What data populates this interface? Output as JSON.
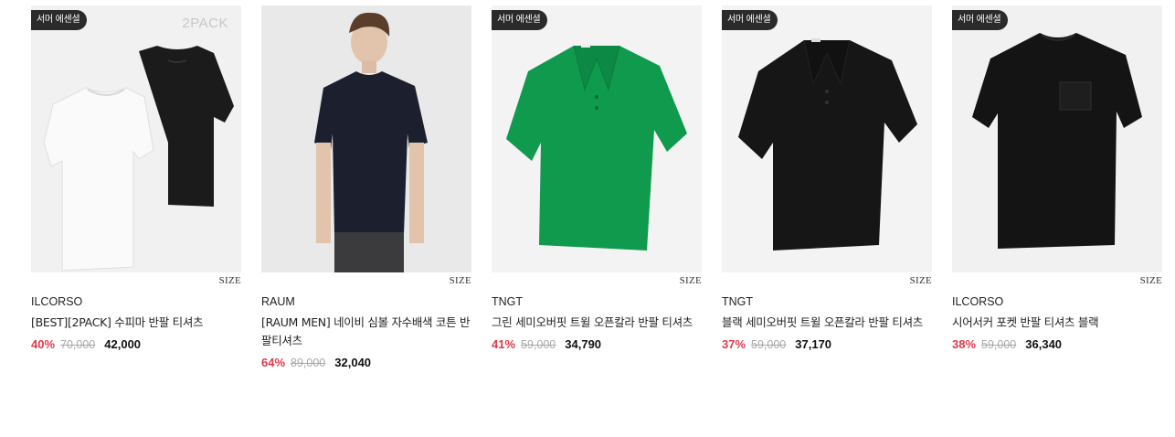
{
  "products": [
    {
      "badge": "서머 에센셜",
      "pack": "2PACK",
      "size": "SIZE",
      "brand": "ILCORSO",
      "name": "[BEST][2PACK] 수피마 반팔 티셔츠",
      "discount": "40%",
      "original": "70,000",
      "price": "42,000",
      "image": "two-pack-white-black-tshirts"
    },
    {
      "badge": "",
      "pack": "",
      "size": "SIZE",
      "brand": "RAUM",
      "name": "[RAUM MEN] 네이비 심볼 자수배색 코튼 반팔티셔츠",
      "discount": "64%",
      "original": "89,000",
      "price": "32,040",
      "image": "model-navy-tshirt"
    },
    {
      "badge": "서머 에센셜",
      "pack": "",
      "size": "SIZE",
      "brand": "TNGT",
      "name": "그린 세미오버핏 트윌 오픈칼라 반팔 티셔츠",
      "discount": "41%",
      "original": "59,000",
      "price": "34,790",
      "image": "green-polo-shirt"
    },
    {
      "badge": "서머 에센셜",
      "pack": "",
      "size": "SIZE",
      "brand": "TNGT",
      "name": "블랙 세미오버핏 트윌 오픈칼라 반팔 티셔츠",
      "discount": "37%",
      "original": "59,000",
      "price": "37,170",
      "image": "black-polo-shirt"
    },
    {
      "badge": "서머 에센셜",
      "pack": "",
      "size": "SIZE",
      "brand": "ILCORSO",
      "name": "시어서커 포켓 반팔 티셔츠 블랙",
      "discount": "38%",
      "original": "59,000",
      "price": "36,340",
      "image": "black-pocket-tshirt"
    }
  ],
  "colors": {
    "discount": "#e03a4a",
    "badge_bg": "#2b2b2b",
    "original": "#a8a8a8"
  }
}
